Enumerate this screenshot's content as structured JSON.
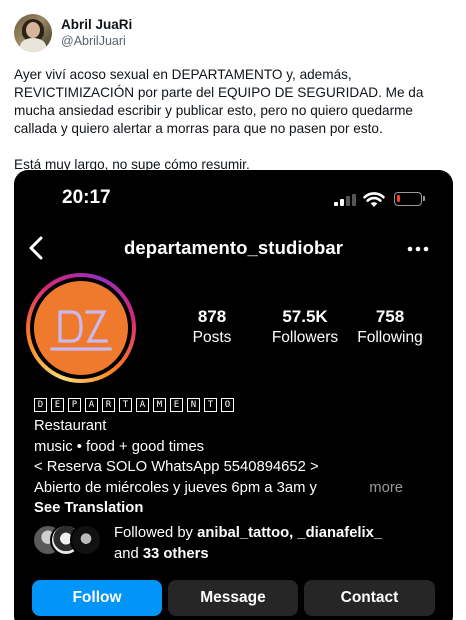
{
  "tweet": {
    "display_name": "Abril JuaRi",
    "handle": "@AbrilJuari",
    "avatar_icon": "user-avatar-photo",
    "text_paragraph_1": "Ayer viví acoso sexual en DEPARTAMENTO y, además, REVICTIMIZACIÓN por parte del EQUIPO DE SEGURIDAD. Me da mucha ansiedad escribir y publicar esto, pero no quiero quedarme callada y quiero alertar a morras para que no pasen por esto.",
    "text_paragraph_2": "Está muy largo, no supe cómo resumir."
  },
  "screenshot": {
    "status_bar": {
      "time": "20:17",
      "signal_bars_active": 2,
      "battery_level": 0.12,
      "battery_color": "#ff3b30"
    },
    "nav": {
      "back_icon": "chevron-left-icon",
      "username": "departamento_studiobar",
      "more_icon": "more-dots-icon"
    },
    "profile": {
      "logo_text": "DZ",
      "logo_bg": "#ef7a2e",
      "logo_fg": "#c9b9ee",
      "stats": {
        "posts_value": "878",
        "posts_label": "Posts",
        "followers_value": "57.5K",
        "followers_label": "Followers",
        "following_value": "758",
        "following_label": "Following"
      },
      "bio": {
        "name_letters": [
          "D",
          "E",
          "P",
          "A",
          "R",
          "T",
          "A",
          "M",
          "E",
          "N",
          "T",
          "O"
        ],
        "category": "Restaurant",
        "line_1": "music • food + good times",
        "line_2": "< Reserva SOLO WhatsApp 5540894652 >",
        "line_3": "Abierto de miércoles y jueves 6pm a 3am y",
        "more_label": "more",
        "see_translation": "See Translation"
      },
      "followed_by": {
        "prefix": "Followed by",
        "accounts": "anibal_tattoo, _dianafelix_",
        "joiner": "and",
        "others": "33 others"
      }
    },
    "actions": {
      "follow_label": "Follow",
      "message_label": "Message",
      "contact_label": "Contact",
      "follow_color": "#0095f6",
      "secondary_color": "#262626"
    }
  }
}
